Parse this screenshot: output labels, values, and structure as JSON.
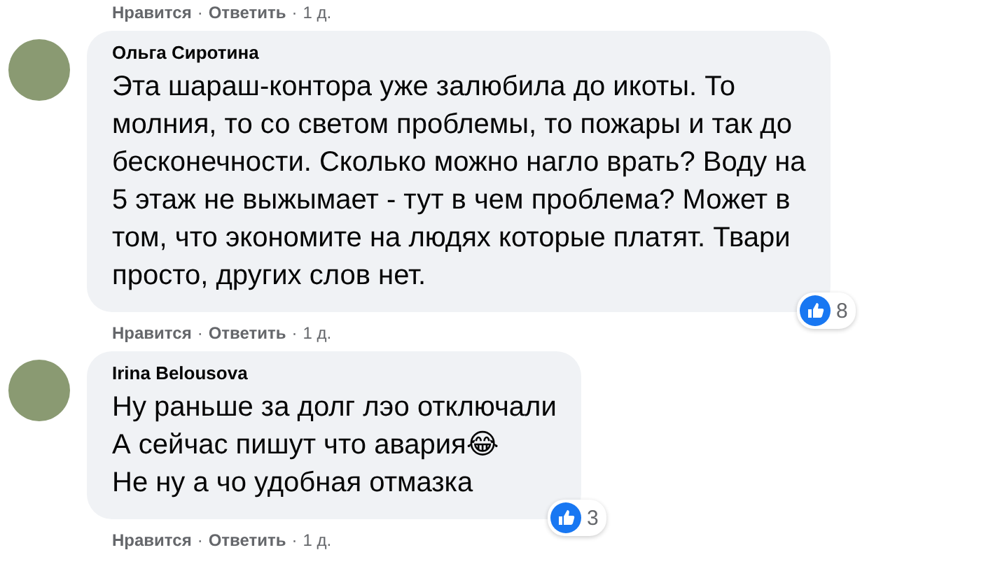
{
  "comments": [
    {
      "kind": "actions",
      "actions": {
        "like": "Нравится",
        "separator": "·",
        "reply": "Ответить",
        "separator_2": "·",
        "time": "1 д."
      }
    },
    {
      "kind": "comment",
      "author": "Ольга Сиротина",
      "text": "Эта шараш-контора уже залюбила до икоты. То\nмолния, то со светом проблемы, то пожары и так до\nбесконечности. Сколько можно нагло врать? Воду на\n5 этаж не выжымает - тут в чем проблема? Может в\nтом, что экономите на людях которые платят. Твари\nпросто, других слов нет.",
      "reactions": "8",
      "actions": {
        "like": "Нравится",
        "separator": "·",
        "reply": "Ответить",
        "separator_2": "·",
        "time": "1 д."
      }
    },
    {
      "kind": "comment",
      "author": "Irina Belousova",
      "text": "Ну раньше за долг лэо отключали\nА сейчас пишут что авария😂\nНе ну а чо удобная отмазка",
      "reactions": "3",
      "actions": {
        "like": "Нравится",
        "separator": "·",
        "reply": "Ответить",
        "separator_2": "·",
        "time": "1 д."
      }
    }
  ]
}
